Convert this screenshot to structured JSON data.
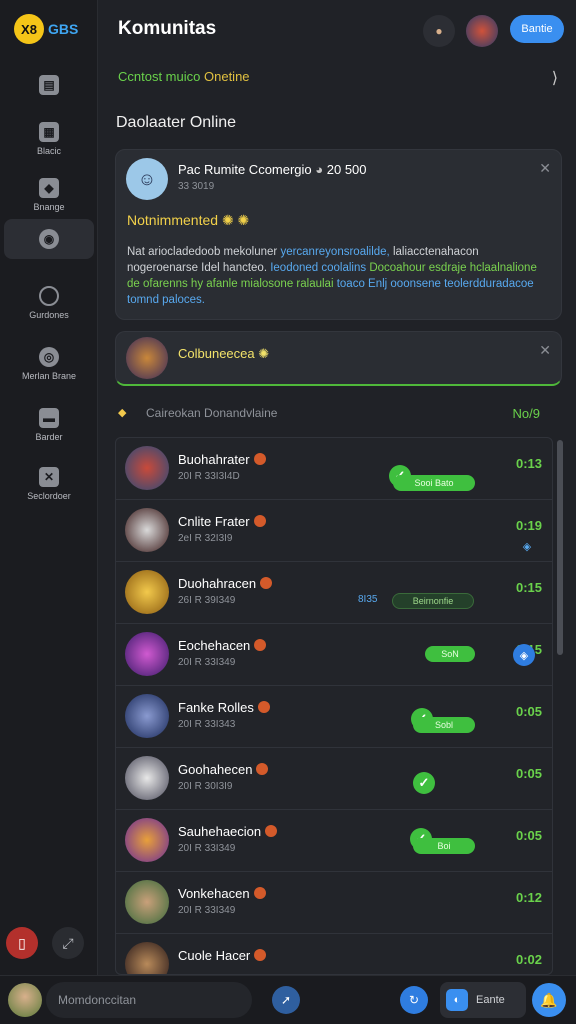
{
  "logo": {
    "mark": "X8",
    "text": "GBS"
  },
  "header": {
    "title": "Komunitas",
    "button_label": "Bantie"
  },
  "sidebar": {
    "items": [
      {
        "label": "",
        "icon": "document-icon"
      },
      {
        "label": "Blacic",
        "icon": "book-icon"
      },
      {
        "label": "Bnange",
        "icon": "cube-icon"
      },
      {
        "label": "",
        "icon": "target-icon"
      },
      {
        "label": "Gurdones",
        "icon": "cloud-icon"
      },
      {
        "label": "Merlan Brane",
        "icon": "ring-icon"
      },
      {
        "label": "Barder",
        "icon": "folder-icon"
      },
      {
        "label": "Seclordoer",
        "icon": "swap-icon"
      }
    ]
  },
  "filters": {
    "text_green": "Ccntost muico",
    "text_yellow": "Onetine"
  },
  "section_title": "Daolaater Online",
  "post": {
    "name": "Pac Rumite Ccomergio",
    "time": "20 500",
    "meta": "33 3019",
    "badge": "Notnimmented",
    "body_1": "Nat ariocladedoob mekoluner ",
    "body_2": "yercanreyonsroalilde,",
    "body_3": " laliacctenahacon nogeroenarse Idel hancteo. ",
    "body_4": "Ieodoned coolalins",
    "body_5": " Docoahour esdraje hclaalnalione de ofarenns hy afanle mialosone ralaulai ",
    "body_6": "toaco Enlj ooonsene teolerdduradacoe tomnd paloces."
  },
  "notice": {
    "text": "Colbuneecea"
  },
  "online_list": {
    "label": "Caireokan Donandvlaine",
    "count": "No/9",
    "rows": [
      {
        "name": "Buohahrater",
        "sub": "20I R 33I3I4D",
        "time": "0:13",
        "pill": "Sooi Bato"
      },
      {
        "name": "Cnlite Frater",
        "sub": "2eI R 32I3I9",
        "time": "0:19",
        "pill": ""
      },
      {
        "name": "Duohahracen",
        "sub": "26I R 39I349",
        "time": "0:15",
        "pill": "Beirnonfie",
        "extra": "8I35"
      },
      {
        "name": "Eochehacen",
        "sub": "20I R 33I349",
        "time": "0:15",
        "pill": "SoN"
      },
      {
        "name": "Fanke Rolles",
        "sub": "20I R 33I343",
        "time": "0:05",
        "pill": "Sobl"
      },
      {
        "name": "Goohahecen",
        "sub": "20I R 30I3I9",
        "time": "0:05",
        "pill": ""
      },
      {
        "name": "Sauhehaecion",
        "sub": "20I R 33I349",
        "time": "0:05",
        "pill": "Boi"
      },
      {
        "name": "Vonkehacen",
        "sub": "20I R 33I349",
        "time": "0:12",
        "pill": ""
      },
      {
        "name": "Cuole Hacer",
        "sub": "",
        "time": "0:02",
        "pill": ""
      }
    ]
  },
  "bottom_bar": {
    "input_placeholder": "Momdonccitan",
    "chip_label": "Eante"
  },
  "colors": {
    "accent": "#3a8ff0",
    "online": "#6ad24b",
    "warning": "#f2d14a",
    "background": "#202227"
  }
}
